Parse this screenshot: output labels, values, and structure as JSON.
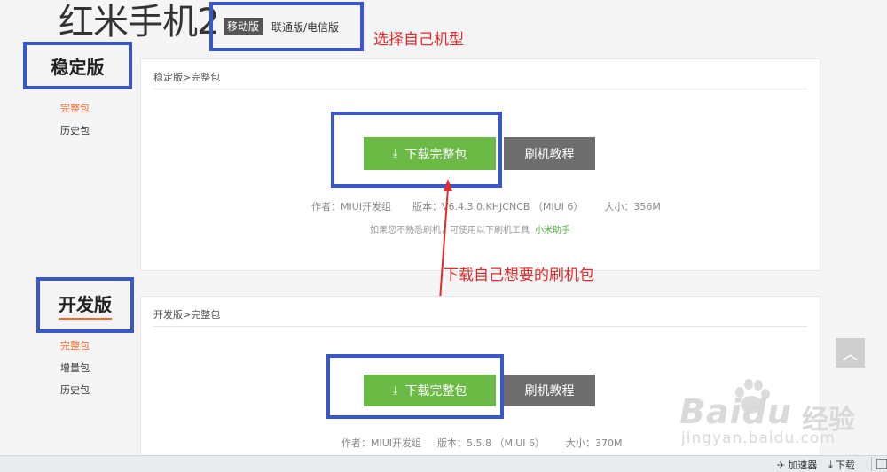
{
  "page_title": "红米手机2",
  "model_tabs": {
    "mobile": "移动版",
    "unicom": "联通版/电信版"
  },
  "annotations": {
    "select_model": "选择自己机型",
    "download_pkg": "下载自己想要的刷机包"
  },
  "stable": {
    "label": "稳定版",
    "side_items": [
      "完整包",
      "历史包"
    ],
    "breadcrumb": "稳定版>完整包",
    "download_btn": "下载完整包",
    "tutorial_btn": "刷机教程",
    "author": "作者：MIUI开发组",
    "version": "版本：V6.4.3.0.KHJCNCB （MIUI 6）",
    "size": "大小：356M",
    "hint": "如果您不熟悉刷机，可使用以下刷机工具",
    "assistant": "小米助手"
  },
  "dev": {
    "label": "开发版",
    "side_items": [
      "完整包",
      "增量包",
      "历史包"
    ],
    "breadcrumb": "开发版>完整包",
    "download_btn": "下载完整包",
    "tutorial_btn": "刷机教程",
    "author": "作者：MIUI开发组",
    "version": "版本：5.5.8 （MIUI 6）",
    "size": "大小：370M"
  },
  "watermark": {
    "logo": "Baidu",
    "jingyan": "经验",
    "url": "jingyan.baidu.com"
  },
  "statusbar": {
    "accelerator": "加速器",
    "download": "下载"
  },
  "colors": {
    "annotation": "#e42a2a",
    "box": "#3a57c9",
    "download_green": "#6aba45",
    "active_orange": "#f06a2c"
  }
}
